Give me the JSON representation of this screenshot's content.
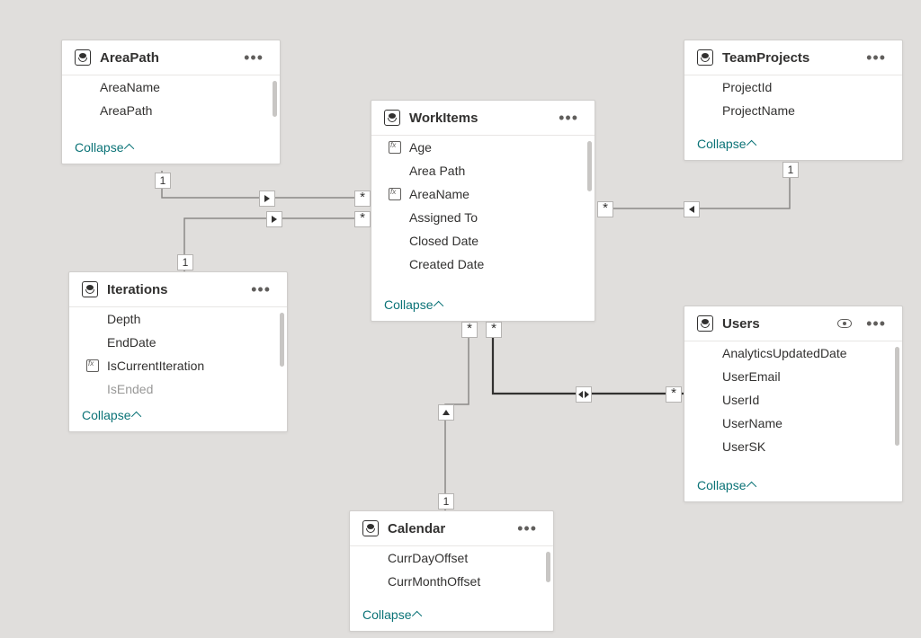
{
  "collapse_label": "Collapse",
  "tables": {
    "areapath": {
      "title": "AreaPath",
      "fields": [
        {
          "icon": "",
          "name": "AreaName"
        },
        {
          "icon": "",
          "name": "AreaPath"
        }
      ]
    },
    "workitems": {
      "title": "WorkItems",
      "fields": [
        {
          "icon": "fx",
          "name": "Age"
        },
        {
          "icon": "",
          "name": "Area Path"
        },
        {
          "icon": "fx",
          "name": "AreaName"
        },
        {
          "icon": "",
          "name": "Assigned To"
        },
        {
          "icon": "",
          "name": "Closed Date"
        },
        {
          "icon": "",
          "name": "Created Date"
        }
      ]
    },
    "teamprojects": {
      "title": "TeamProjects",
      "fields": [
        {
          "icon": "",
          "name": "ProjectId"
        },
        {
          "icon": "",
          "name": "ProjectName"
        }
      ]
    },
    "iterations": {
      "title": "Iterations",
      "fields": [
        {
          "icon": "",
          "name": "Depth"
        },
        {
          "icon": "",
          "name": "EndDate"
        },
        {
          "icon": "fx",
          "name": "IsCurrentIteration"
        },
        {
          "icon": "",
          "name": "IsEnded"
        }
      ]
    },
    "users": {
      "title": "Users",
      "fields": [
        {
          "icon": "",
          "name": "AnalyticsUpdatedDate"
        },
        {
          "icon": "",
          "name": "UserEmail"
        },
        {
          "icon": "",
          "name": "UserId"
        },
        {
          "icon": "",
          "name": "UserName"
        },
        {
          "icon": "",
          "name": "UserSK"
        }
      ]
    },
    "calendar": {
      "title": "Calendar",
      "fields": [
        {
          "icon": "",
          "name": "CurrDayOffset"
        },
        {
          "icon": "",
          "name": "CurrMonthOffset"
        }
      ]
    }
  },
  "cardinality": {
    "one": "1",
    "many": "*"
  },
  "relationships": [
    {
      "from": "AreaPath",
      "to": "WorkItems",
      "from_card": "1",
      "to_card": "*",
      "direction": "single"
    },
    {
      "from": "Iterations",
      "to": "WorkItems",
      "from_card": "1",
      "to_card": "*",
      "direction": "single"
    },
    {
      "from": "TeamProjects",
      "to": "WorkItems",
      "from_card": "1",
      "to_card": "*",
      "direction": "single"
    },
    {
      "from": "Calendar",
      "to": "WorkItems",
      "from_card": "1",
      "to_card": "*",
      "direction": "single"
    },
    {
      "from": "Users",
      "to": "WorkItems",
      "from_card": "*",
      "to_card": "*",
      "direction": "both"
    }
  ]
}
